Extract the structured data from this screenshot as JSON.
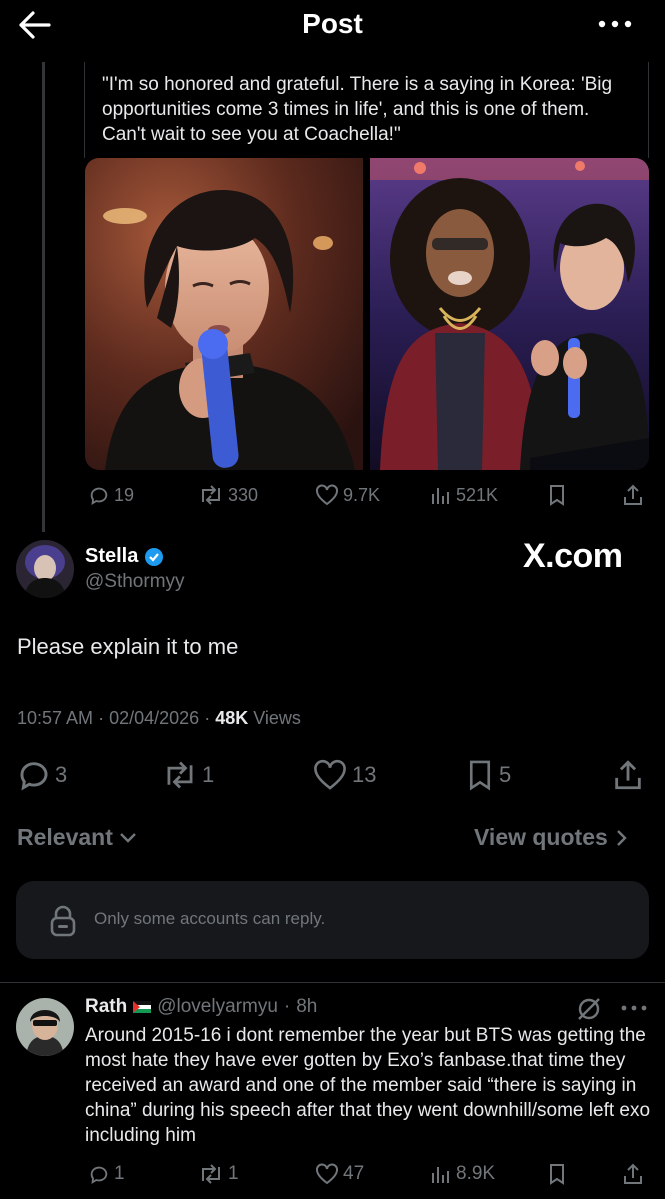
{
  "header": {
    "title": "Post"
  },
  "quoted": {
    "text": "\"I'm so honored and grateful. There is a saying in Korea: 'Big opportunities come 3 times in life', and this is one of them. Can't wait to see you at Coachella!\"",
    "actions": {
      "replies": "19",
      "reposts": "330",
      "likes": "9.7K",
      "views": "521K"
    }
  },
  "post": {
    "author_name": "Stella",
    "author_handle": "@Sthormyy",
    "watermark": "X.com",
    "text": "Please explain it to me",
    "time": "10:57 AM",
    "date": "02/04/2026",
    "views_count": "48K",
    "views_label": "Views",
    "actions": {
      "replies": "3",
      "reposts": "1",
      "likes": "13",
      "bookmarks": "5"
    }
  },
  "filters": {
    "sort_label": "Relevant",
    "quotes_label": "View quotes"
  },
  "reply_restriction": "Only some accounts can reply.",
  "reply": {
    "name": "Rath",
    "handle": "@lovelyarmyu",
    "time": "8h",
    "text": "Around 2015-16 i dont remember the year but BTS was getting the most hate they have ever gotten by Exo’s fanbase.that time they received an award and one of the member said “there is saying in china” during his speech after that they went downhill/some left exo including him",
    "actions": {
      "replies": "1",
      "reposts": "1",
      "likes": "47",
      "views": "8.9K"
    }
  },
  "colors": {
    "background": "#000000",
    "text": "#e7e9ea",
    "muted": "#71767b",
    "verified": "#1d9bf0"
  },
  "icons": [
    "back-arrow-icon",
    "more-icon",
    "reply-icon",
    "repost-icon",
    "like-icon",
    "views-icon",
    "bookmark-icon",
    "share-icon",
    "verified-icon",
    "chevron-down-icon",
    "chevron-right-icon",
    "lock-icon",
    "grok-icon"
  ]
}
